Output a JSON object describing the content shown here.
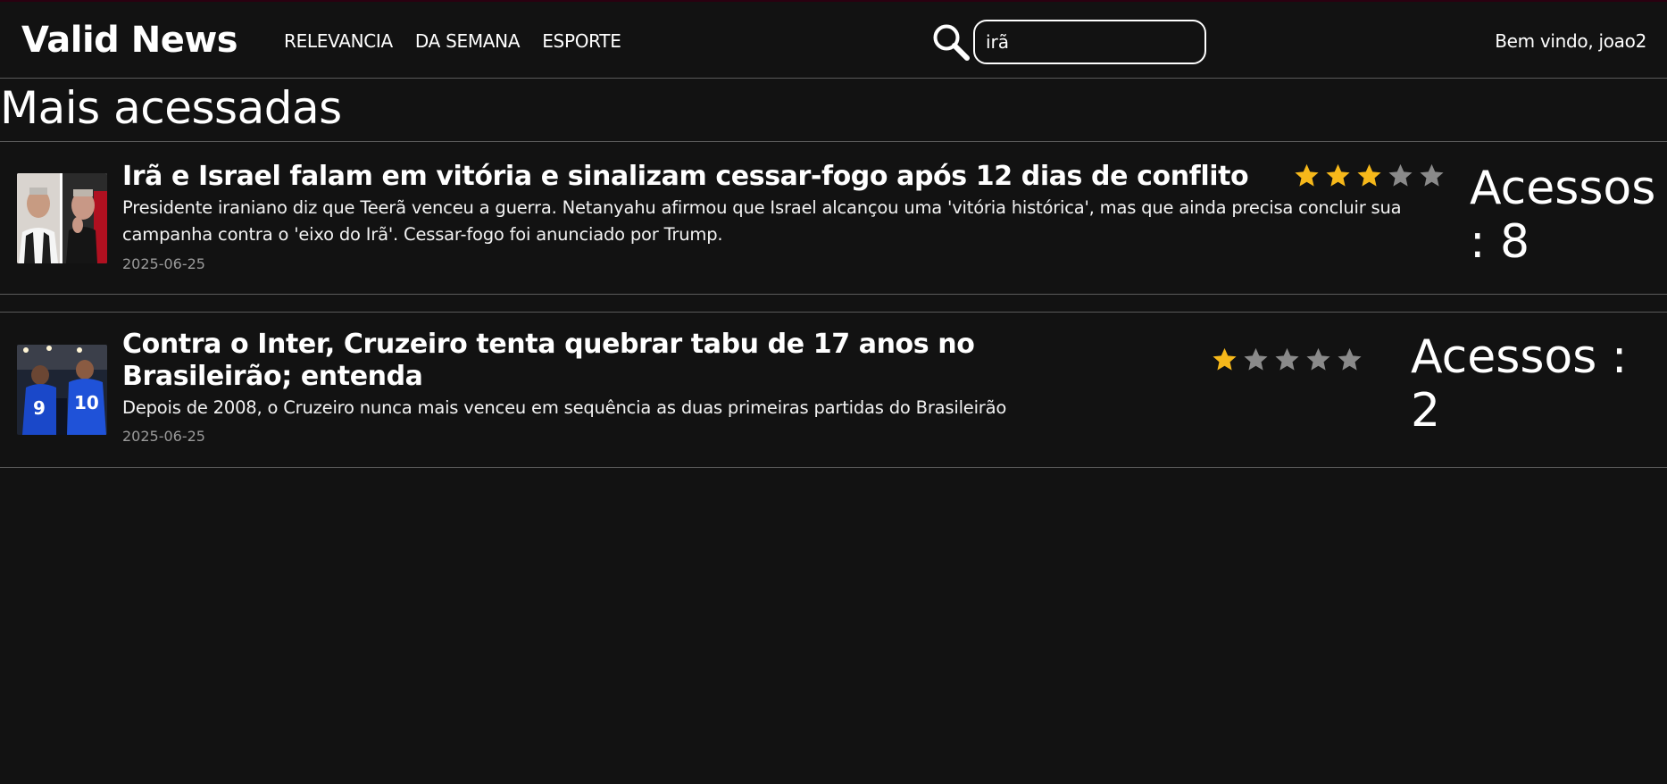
{
  "header": {
    "brand": "Valid News",
    "nav": [
      "RELEVANCIA",
      "DA SEMANA",
      "ESPORTE"
    ],
    "search": {
      "value": "irã",
      "icon": "search-icon"
    },
    "welcome": "Bem vindo, joao2"
  },
  "main": {
    "title": "Mais acessadas",
    "articles": [
      {
        "title": "Irã e Israel falam em vitória e sinalizam cessar-fogo após 12 dias de conflito",
        "description": "Presidente iraniano diz que Teerã venceu a guerra. Netanyahu afirmou que Israel alcançou uma 'vitória histórica', mas que ainda precisa concluir sua campanha contra o 'eixo do Irã'. Cessar-fogo foi anunciado por Trump.",
        "date": "2025-06-25",
        "rating": 3,
        "max_rating": 5,
        "access_line1": "Acessos",
        "access_line2": ": 8"
      },
      {
        "title": "Contra o Inter, Cruzeiro tenta quebrar tabu de 17 anos no Brasileirão; entenda",
        "description": "Depois de 2008, o Cruzeiro nunca mais venceu em sequência as duas primeiras partidas do Brasileirão",
        "date": "2025-06-25",
        "rating": 1,
        "max_rating": 5,
        "access_line1": "Acessos :",
        "access_line2": "2"
      }
    ]
  },
  "colors": {
    "background": "#121212",
    "star_filled": "#f6b81a",
    "star_empty": "#8a8a8a",
    "divider": "#5a5a5a"
  }
}
